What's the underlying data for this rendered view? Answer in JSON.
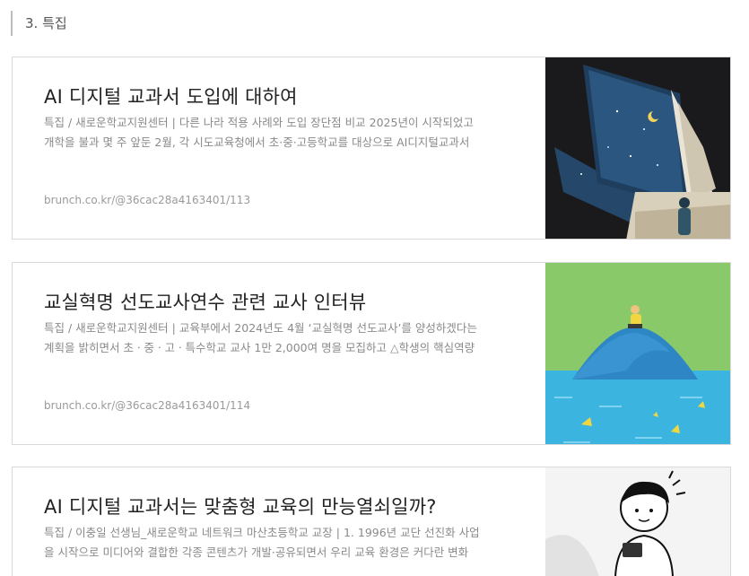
{
  "section": {
    "heading": "3. 특집"
  },
  "cards": [
    {
      "title": "AI 디지털 교과서 도입에 대하여",
      "desc_line1": "특집 / 새로운학교지원센터 | 다른 나라 적용 사례와 도입 장단점 비교 2025년이 시작되었고",
      "desc_line2": "개학을 불과 몇 주 앞둔 2월, 각 시도교육청에서 초·중·고등학교를 대상으로 AI디지털교과서",
      "url": "brunch.co.kr/@36cac28a4163401/113",
      "image_icon": "open-book-night-sky-illustration"
    },
    {
      "title": "교실혁명 선도교사연수 관련 교사 인터뷰",
      "desc_line1": "특집 / 새로운학교지원센터 | 교육부에서 2024년도 4월 ‘교실혁명 선도교사’를 양성하겠다는",
      "desc_line2": "계획을 밝히면서 초ㆍ중ㆍ고ㆍ특수학교 교사 1만 2,000여 명을 모집하고 △학생의 핵심역량",
      "url": "brunch.co.kr/@36cac28a4163401/114",
      "image_icon": "island-reader-illustration"
    },
    {
      "title": "AI 디지털 교과서는 맞춤형 교육의 만능열쇠일까?",
      "desc_line1": "특집 / 이충일 선생님_새로운학교 네트워크 마산초등학교 교장 | 1. 1996년 교단 선진화 사업",
      "desc_line2": "을 시작으로 미디어와 결합한 각종 콘텐츠가 개발·공유되면서 우리 교육 환경은 커다란 변화",
      "url": "",
      "image_icon": "student-tablet-illustration"
    }
  ],
  "colors": {
    "sea": "#3bb4e0",
    "grass": "#8ac96a",
    "night": "#1d3a55"
  }
}
